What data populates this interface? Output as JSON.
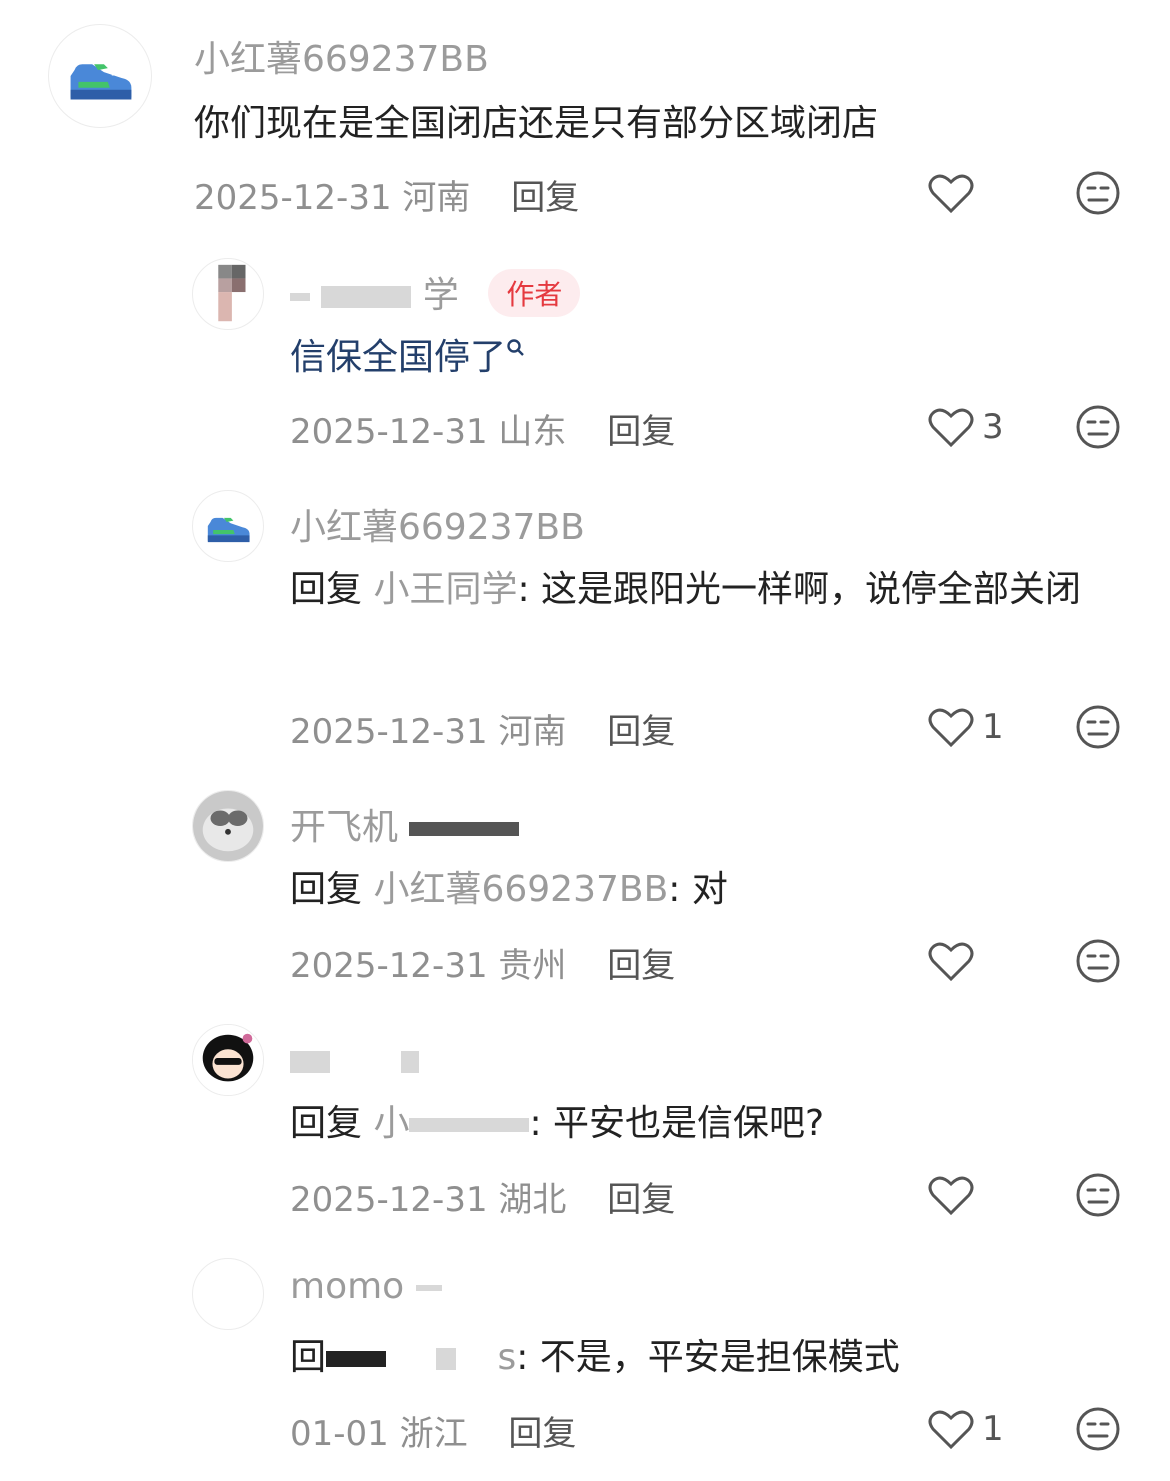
{
  "comments": [
    {
      "username": "小红薯669237BB",
      "text": "你们现在是全国闭店还是只有部分区域闭店",
      "date": "2025-12-31",
      "location": "河南",
      "reply_label": "回复",
      "likes": ""
    },
    {
      "username": "学",
      "author_badge": "作者",
      "text": "信保全国停了",
      "date": "2025-12-31",
      "location": "山东",
      "reply_label": "回复",
      "likes": "3"
    },
    {
      "username": "小红薯669237BB",
      "reply_prefix": "回复",
      "reply_target": "小王同学",
      "text": ": 这是跟阳光一样啊，说停全部关闭",
      "date": "2025-12-31",
      "location": "河南",
      "reply_label": "回复",
      "likes": "1"
    },
    {
      "username": "开飞机",
      "reply_prefix": "回复",
      "reply_target": "小红薯669237BB",
      "text": ": 对",
      "date": "2025-12-31",
      "location": "贵州",
      "reply_label": "回复",
      "likes": ""
    },
    {
      "username": "",
      "reply_prefix": "回复",
      "reply_target": "小",
      "text": ": 平安也是信保吧?",
      "date": "2025-12-31",
      "location": "湖北",
      "reply_label": "回复",
      "likes": ""
    },
    {
      "username": "momo",
      "reply_prefix": "回",
      "reply_target": "s",
      "text": ": 不是，平安是担保模式",
      "date": "01-01",
      "location": "浙江",
      "reply_label": "回复",
      "likes": "1"
    }
  ],
  "icons": {
    "like": "heart-icon",
    "dislike": "dislike-face-icon",
    "search_hint": "search-icon"
  },
  "colors": {
    "author_badge_bg": "#fdecee",
    "author_badge_text": "#e5393f",
    "link": "#233f6b"
  }
}
